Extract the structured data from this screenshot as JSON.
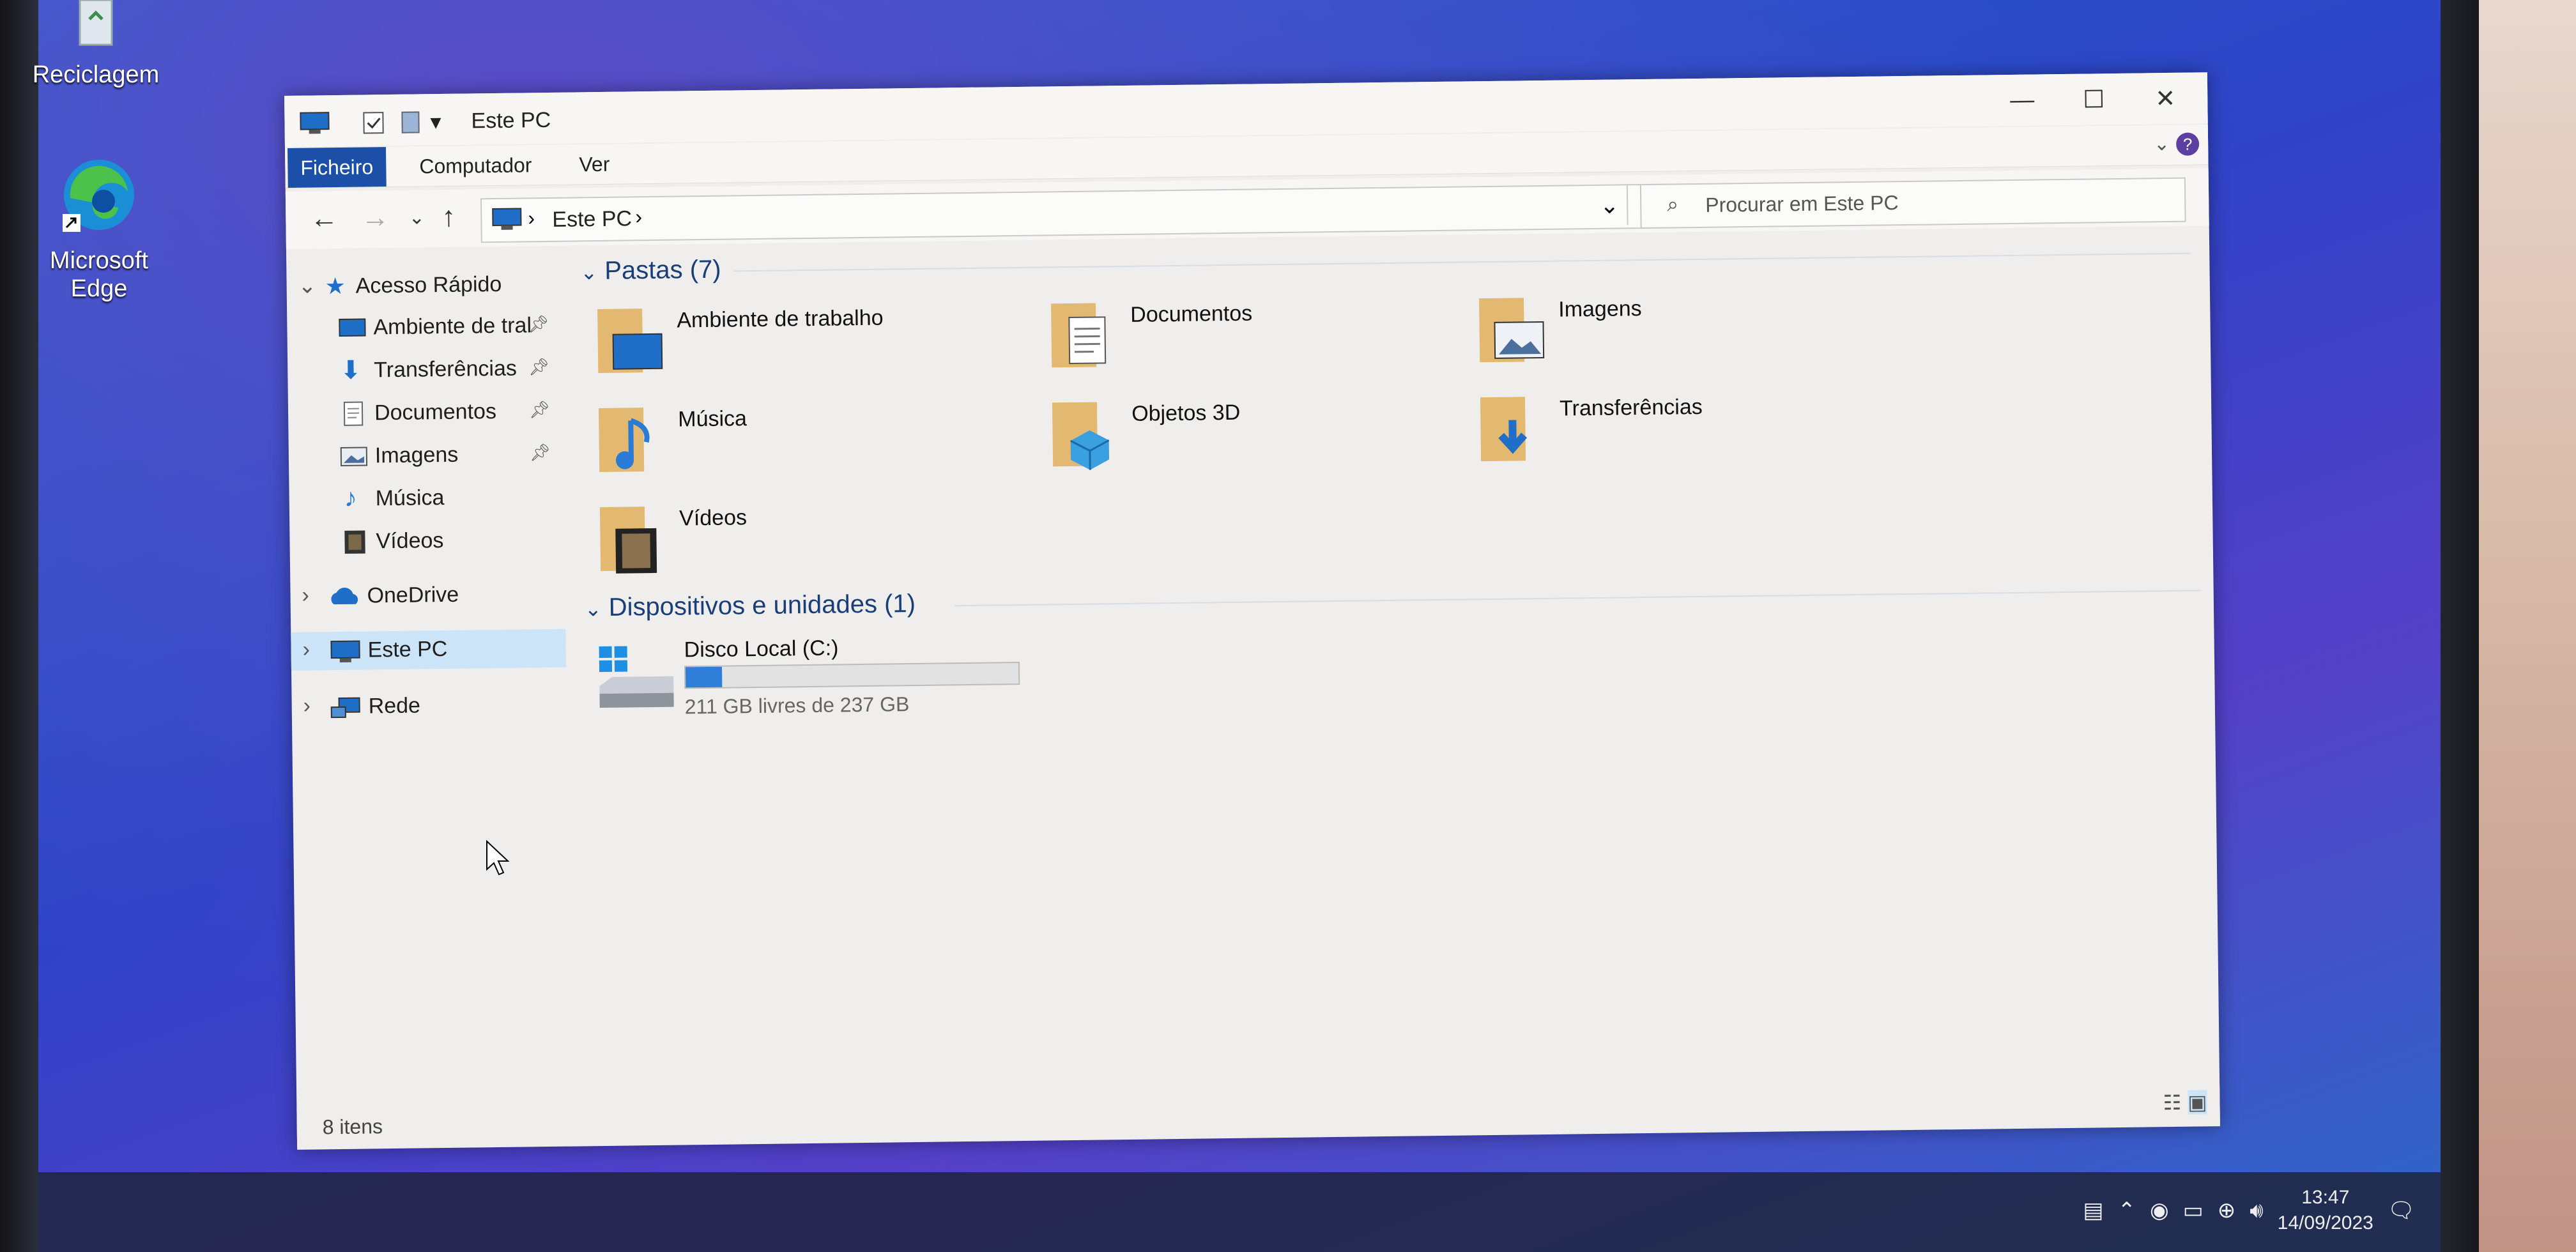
{
  "desktop": {
    "icons": [
      {
        "label": "Reciclagem"
      },
      {
        "label": "Microsoft Edge"
      }
    ]
  },
  "window": {
    "title": "Este PC",
    "ribbon_tabs": [
      "Ficheiro",
      "Computador",
      "Ver"
    ],
    "address": {
      "path": [
        "Este PC"
      ]
    },
    "search": {
      "placeholder": "Procurar em Este PC"
    },
    "nav_pane": {
      "quick_access": {
        "label": "Acesso Rápido",
        "items": [
          {
            "label": "Ambiente de tral",
            "icon": "desktop-icon",
            "pinned": true
          },
          {
            "label": "Transferências",
            "icon": "download-icon",
            "pinned": true
          },
          {
            "label": "Documentos",
            "icon": "document-icon",
            "pinned": true
          },
          {
            "label": "Imagens",
            "icon": "image-icon",
            "pinned": true
          },
          {
            "label": "Música",
            "icon": "music-icon",
            "pinned": false
          },
          {
            "label": "Vídeos",
            "icon": "video-icon",
            "pinned": false
          }
        ]
      },
      "onedrive": {
        "label": "OneDrive"
      },
      "this_pc": {
        "label": "Este PC"
      },
      "network": {
        "label": "Rede"
      }
    },
    "folders_group": {
      "header": "Pastas (7)",
      "items": [
        {
          "label": "Ambiente de trabalho",
          "icon": "desktop-folder-icon"
        },
        {
          "label": "Documentos",
          "icon": "documents-folder-icon"
        },
        {
          "label": "Imagens",
          "icon": "pictures-folder-icon"
        },
        {
          "label": "Música",
          "icon": "music-folder-icon"
        },
        {
          "label": "Objetos 3D",
          "icon": "3d-objects-folder-icon"
        },
        {
          "label": "Transferências",
          "icon": "downloads-folder-icon"
        },
        {
          "label": "Vídeos",
          "icon": "videos-folder-icon"
        }
      ]
    },
    "devices_group": {
      "header": "Dispositivos e unidades (1)",
      "drives": [
        {
          "label": "Disco Local (C:)",
          "free_text": "211 GB livres de 237 GB",
          "used_fraction": 0.11
        }
      ]
    },
    "status": {
      "item_count": "8 itens"
    }
  },
  "taskbar": {
    "time": "13:47",
    "date": "14/09/2023"
  },
  "colors": {
    "accent": "#1b4fa8",
    "drive_fill": "#2f7fd9",
    "selected": "#cce4f7"
  }
}
